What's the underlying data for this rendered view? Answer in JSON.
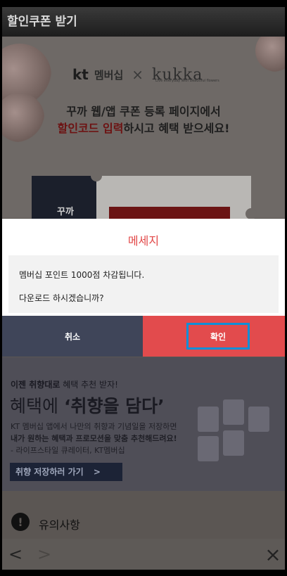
{
  "app": {
    "title": "할인쿠폰 받기"
  },
  "banner": {
    "kt_logo": "kt",
    "kt_member": "멤버십",
    "cross": "×",
    "partner": "kukka",
    "partner_tagline": "Live everyday with beautiful flowers",
    "headline1": "꾸까 웹/앱 쿠폰 등록 페이지에서",
    "headline2_accent": "할인코드 입력",
    "headline2_rest": "하시고 혜택 받으세요!",
    "coupon_label": "꾸까"
  },
  "dialog": {
    "title": "메세지",
    "message_line1": "멤버십 포인트 1000점 차감됩니다.",
    "message_line2": "다운로드 하시겠습니까?",
    "cancel_label": "취소",
    "confirm_label": "확인"
  },
  "promo": {
    "line1_bold": "이젠 취향대로",
    "line1_rest": " 혜택 추천 받자!",
    "headline_prefix": "혜택에 ",
    "headline_bold": "‘취향을 담다’",
    "desc1": "KT 멤버십 앱에서 나만의 취향과 기념일을 저장하면",
    "desc2": "내가 원하는 혜택과 프로모션을 맞춤 추천해드려요!",
    "desc3": "- 라이프스타일 큐레이터, KT멤버십",
    "button_label": "취향 저장하러 가기",
    "button_arrow": ">"
  },
  "notice": {
    "icon": "!",
    "label": "유의사항"
  },
  "nav": {
    "back": "<",
    "forward": ">",
    "close": "×"
  },
  "colors": {
    "accent_red": "#e24b4d",
    "cancel_navy": "#3f4559",
    "highlight_blue": "#0d8fd8"
  }
}
